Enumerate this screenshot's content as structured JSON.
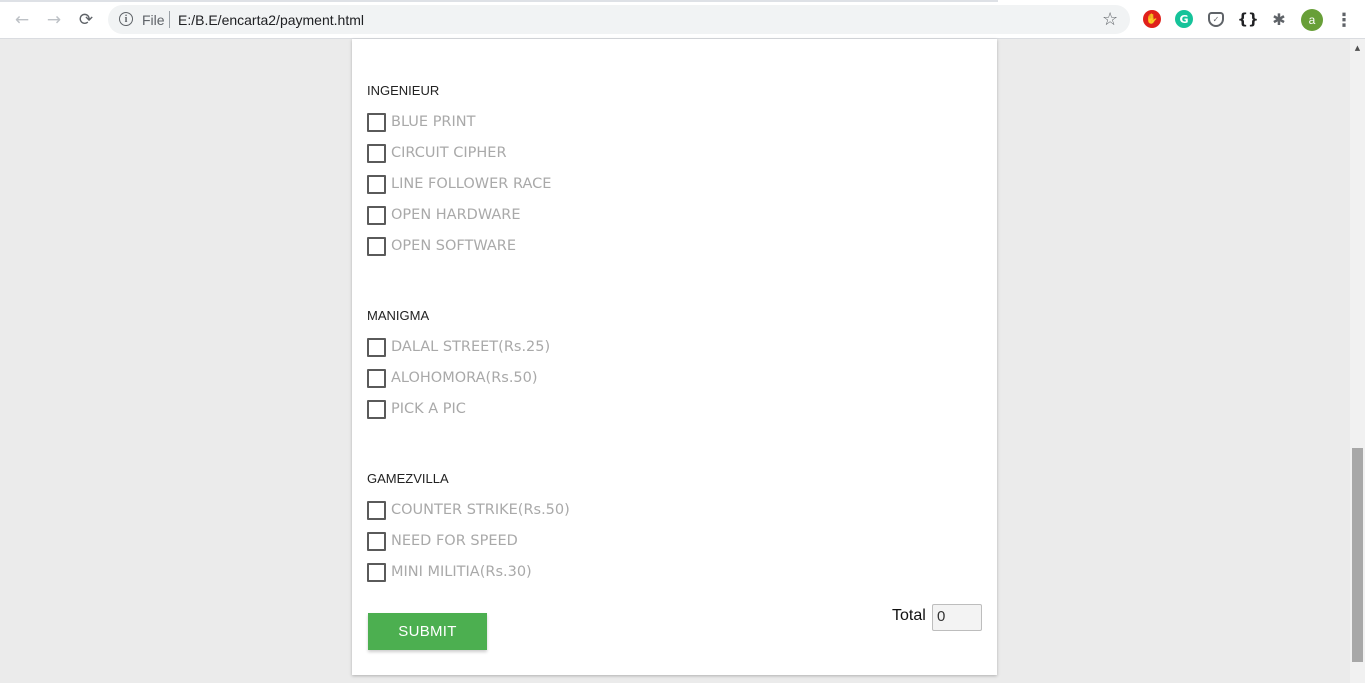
{
  "browser": {
    "back_glyph": "←",
    "forward_glyph": "→",
    "reload_glyph": "⟳",
    "info_glyph": "i",
    "scheme": "File",
    "url": "E:/B.E/encarta2/payment.html",
    "star_glyph": "☆",
    "avatar_letter": "a",
    "grammarly_glyph": "G",
    "braces_glyph": "{}",
    "puzzle_glyph": "✱",
    "menu_glyph": "⋮",
    "icons": [
      "back-arrow-icon",
      "forward-arrow-icon",
      "reload-icon",
      "info-icon",
      "star-icon",
      "adblock-icon",
      "grammarly-icon",
      "pocket-icon",
      "json-braces-icon",
      "extensions-puzzle-icon",
      "profile-avatar",
      "kebab-menu-icon"
    ]
  },
  "sections": [
    {
      "title": "INGENIEUR",
      "options": [
        "BLUE PRINT",
        "CIRCUIT CIPHER",
        "LINE FOLLOWER RACE",
        "OPEN HARDWARE",
        "OPEN SOFTWARE"
      ]
    },
    {
      "title": "MANIGMA",
      "options": [
        "DALAL STREET(Rs.25)",
        "ALOHOMORA(Rs.50)",
        "PICK A PIC"
      ]
    },
    {
      "title": "GAMEZVILLA",
      "options": [
        "COUNTER STRIKE(Rs.50)",
        "NEED FOR SPEED",
        "MINI MILITIA(Rs.30)"
      ]
    }
  ],
  "form": {
    "submit_label": "SUBMIT",
    "total_label": "Total",
    "total_value": "0"
  },
  "colors": {
    "submit_bg": "#4caf50",
    "option_text": "#a9a9a9",
    "page_bg": "#ebebeb",
    "card_bg": "#ffffff"
  }
}
